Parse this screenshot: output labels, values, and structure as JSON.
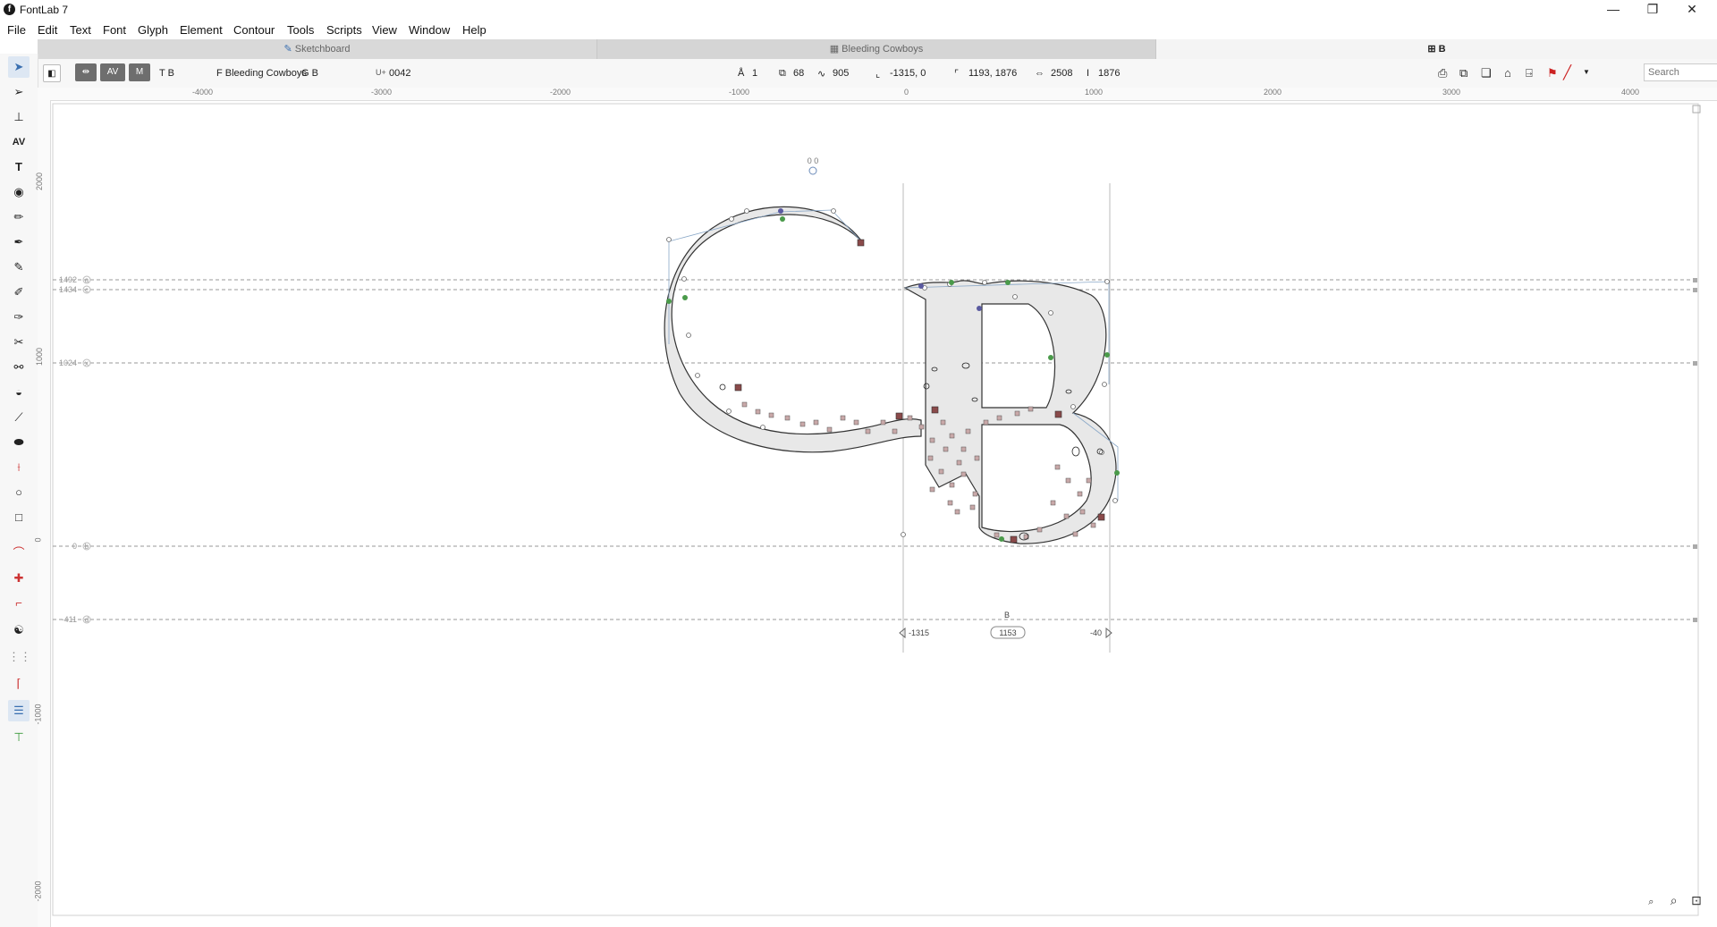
{
  "window": {
    "title": "FontLab 7",
    "controls": [
      "—",
      "❐",
      "✕"
    ]
  },
  "menu": [
    "File",
    "Edit",
    "Text",
    "Font",
    "Glyph",
    "Element",
    "Contour",
    "Tools",
    "Scripts",
    "View",
    "Window",
    "Help"
  ],
  "tabs": [
    {
      "label": "Sketchboard",
      "icon": "pen-icon"
    },
    {
      "label": "Bleeding Cowboys",
      "icon": "grid-icon"
    },
    {
      "label": "B",
      "icon": "glyph-icon"
    }
  ],
  "toolbar": {
    "text_mode": "T B",
    "font_label": "F Bleeding Cowboys",
    "glyph_label": "G B",
    "unicode_prefix": "U+",
    "unicode_value": "0042",
    "layers": "1",
    "contours": "68",
    "nodes": "905",
    "origin": "-1315, 0",
    "size": "1193, 1876",
    "width": "2508",
    "height": "1876",
    "search_placeholder": "Search"
  },
  "rulers": {
    "top": [
      "-4000",
      "-3000",
      "-2000",
      "-1000",
      "0",
      "1000",
      "2000",
      "3000",
      "4000"
    ],
    "left": [
      "2000",
      "1000",
      "0",
      "-1000",
      "-2000"
    ]
  },
  "canvas": {
    "guides": [
      {
        "value": "1492",
        "label": "a"
      },
      {
        "value": "1434",
        "label": "c"
      },
      {
        "value": "1024",
        "label": "x"
      },
      {
        "value": "0",
        "label": "b"
      },
      {
        "value": "-411",
        "label": "d"
      }
    ],
    "anchor_label": "0  0",
    "glyph_name": "B",
    "lsb": "-1315",
    "advance": "1153",
    "rsb": "-40"
  },
  "colors": {
    "accent": "#3a6fb0",
    "fill": "#e8e8e8",
    "node_green": "#3a9a3a",
    "node_red": "#8a3a3a"
  }
}
